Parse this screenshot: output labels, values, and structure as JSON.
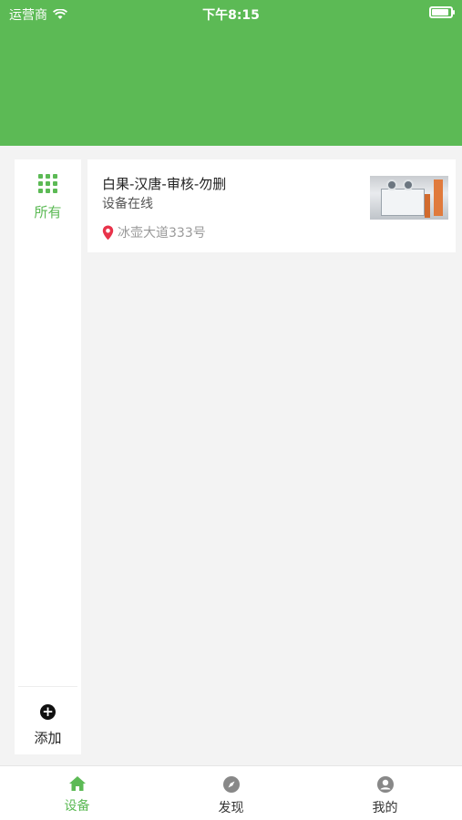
{
  "status_bar": {
    "carrier": "运营商",
    "time": "下午8:15",
    "battery_level": 0.9
  },
  "sidebar": {
    "categories": [
      {
        "label": "所有",
        "icon": "grid-icon",
        "active": true
      }
    ],
    "add": {
      "label": "添加",
      "icon": "plus-circle-icon"
    }
  },
  "devices": [
    {
      "name": "白果-汉唐-审核-勿删",
      "status": "设备在线",
      "address": "冰壶大道333号",
      "location_icon": "location-pin-icon"
    }
  ],
  "tabs": [
    {
      "label": "设备",
      "icon": "home-icon",
      "active": true
    },
    {
      "label": "发现",
      "icon": "compass-icon",
      "active": false
    },
    {
      "label": "我的",
      "icon": "user-icon",
      "active": false
    }
  ],
  "colors": {
    "accent": "#5cba55",
    "background": "#f3f3f3",
    "location_pin": "#e8334a"
  }
}
